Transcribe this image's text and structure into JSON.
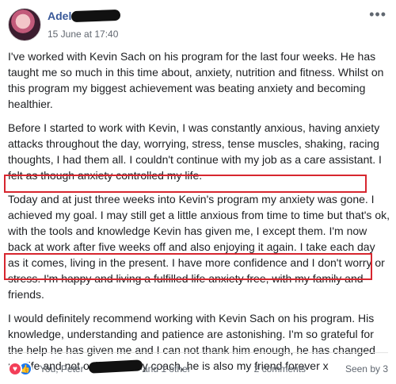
{
  "post": {
    "author": "Adel",
    "timestamp": "15 June at 17:40",
    "more_label": "•••",
    "paragraphs": [
      "I've worked with Kevin Sach on his program for the last four weeks. He has taught me so much in this time about, anxiety, nutrition and fitness. Whilst on this program my biggest achievement was beating anxiety and becoming healthier.",
      "Before I started to work with Kevin, I was constantly anxious, having anxiety attacks throughout the day, worrying, stress, tense muscles, shaking, racing thoughts, I had them all. I couldn't continue with my job as a care assistant. I felt as though anxiety controlled my life.",
      "Today and at just three weeks into Kevin's program my anxiety was gone. I achieved my goal. I may still get a little anxious from time to time but that's ok, with the tools and knowledge Kevin has given me, I except them. I'm now back at work after five weeks off and also enjoying it again. I take each day as it comes, living in the present. I have more confidence and I don't worry or stress. I'm happy and living a fulfilled life anxiety free, with my family and friends.",
      "I would definitely recommend working with Kevin Sach on his program. His knowledge, understanding and patience are astonishing. I'm so grateful for the help he has given me and I can not thank him enough, he has changed my life and not only is he my coach, he is also my friend forever x"
    ]
  },
  "footer": {
    "reactions_text": "You, Peter",
    "and_other": "and 1 other",
    "comments": "2 comments",
    "seen": "Seen by 3"
  },
  "colors": {
    "author": "#385898",
    "highlight": "#d7262f",
    "love": "#f33e58",
    "like": "#1877f2"
  }
}
